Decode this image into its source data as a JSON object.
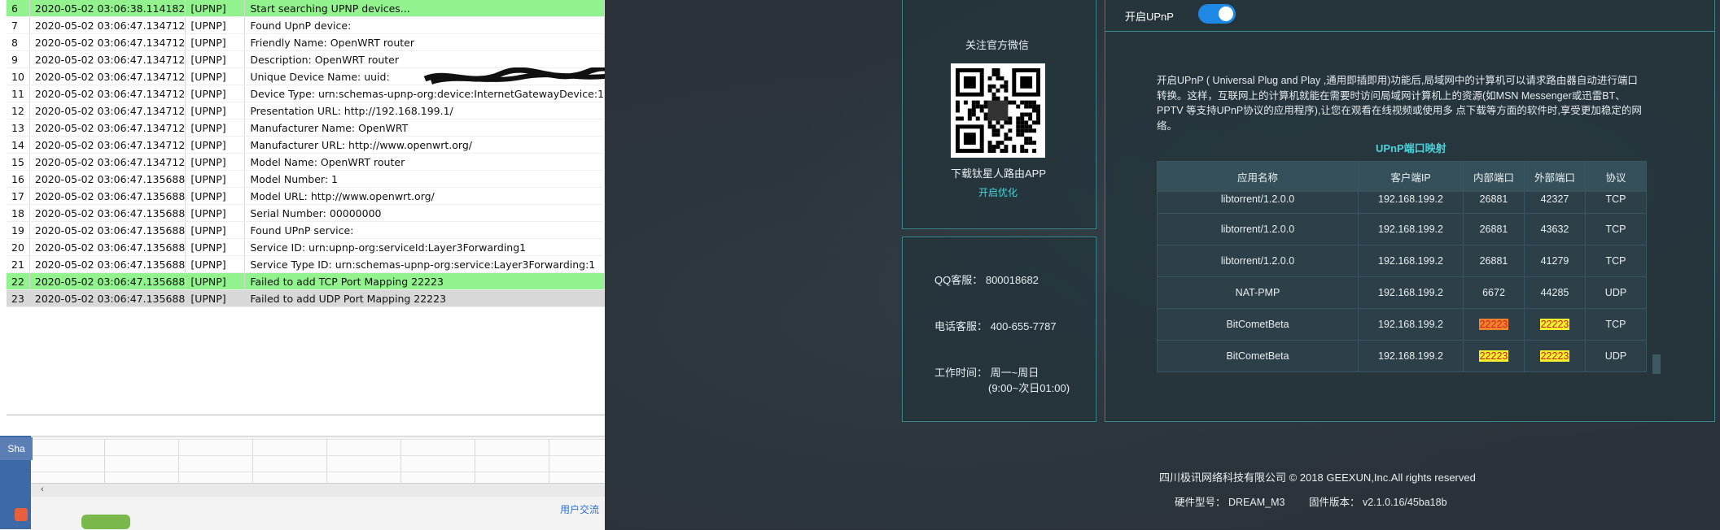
{
  "log": {
    "rows": [
      {
        "num": "6",
        "time": "2020-05-02 03:06:38.114182",
        "tag": "[UPNP]",
        "msg": "Start searching UPNP devices...",
        "hl": "green"
      },
      {
        "num": "7",
        "time": "2020-05-02 03:06:47.134712",
        "tag": "[UPNP]",
        "msg": "Found UpnP device:",
        "hl": ""
      },
      {
        "num": "8",
        "time": "2020-05-02 03:06:47.134712",
        "tag": "[UPNP]",
        "msg": "Friendly Name: OpenWRT router",
        "hl": ""
      },
      {
        "num": "9",
        "time": "2020-05-02 03:06:47.134712",
        "tag": "[UPNP]",
        "msg": "Description: OpenWRT router",
        "hl": ""
      },
      {
        "num": "10",
        "time": "2020-05-02 03:06:47.134712",
        "tag": "[UPNP]",
        "msg": "Unique Device Name: uuid:",
        "hl": ""
      },
      {
        "num": "11",
        "time": "2020-05-02 03:06:47.134712",
        "tag": "[UPNP]",
        "msg": "Device Type: urn:schemas-upnp-org:device:InternetGatewayDevice:1",
        "hl": ""
      },
      {
        "num": "12",
        "time": "2020-05-02 03:06:47.134712",
        "tag": "[UPNP]",
        "msg": "Presentation URL: http://192.168.199.1/",
        "hl": ""
      },
      {
        "num": "13",
        "time": "2020-05-02 03:06:47.134712",
        "tag": "[UPNP]",
        "msg": "Manufacturer Name: OpenWRT",
        "hl": ""
      },
      {
        "num": "14",
        "time": "2020-05-02 03:06:47.134712",
        "tag": "[UPNP]",
        "msg": "Manufacturer URL: http://www.openwrt.org/",
        "hl": ""
      },
      {
        "num": "15",
        "time": "2020-05-02 03:06:47.134712",
        "tag": "[UPNP]",
        "msg": "Model Name: OpenWRT router",
        "hl": ""
      },
      {
        "num": "16",
        "time": "2020-05-02 03:06:47.135688",
        "tag": "[UPNP]",
        "msg": "Model Number: 1",
        "hl": ""
      },
      {
        "num": "17",
        "time": "2020-05-02 03:06:47.135688",
        "tag": "[UPNP]",
        "msg": "Model URL: http://www.openwrt.org/",
        "hl": ""
      },
      {
        "num": "18",
        "time": "2020-05-02 03:06:47.135688",
        "tag": "[UPNP]",
        "msg": "Serial Number: 00000000",
        "hl": ""
      },
      {
        "num": "19",
        "time": "2020-05-02 03:06:47.135688",
        "tag": "[UPNP]",
        "msg": "Found UPnP service:",
        "hl": ""
      },
      {
        "num": "20",
        "time": "2020-05-02 03:06:47.135688",
        "tag": "[UPNP]",
        "msg": "Service ID: urn:upnp-org:serviceId:Layer3Forwarding1",
        "hl": ""
      },
      {
        "num": "21",
        "time": "2020-05-02 03:06:47.135688",
        "tag": "[UPNP]",
        "msg": "Service Type ID: urn:schemas-upnp-org:service:Layer3Forwarding:1",
        "hl": ""
      },
      {
        "num": "22",
        "time": "2020-05-02 03:06:47.135688",
        "tag": "[UPNP]",
        "msg": "Failed to add TCP Port Mapping 22223",
        "hl": "green"
      },
      {
        "num": "23",
        "time": "2020-05-02 03:06:47.135688",
        "tag": "[UPNP]",
        "msg": "Failed to add UDP Port Mapping 22223",
        "hl": "gray"
      }
    ],
    "sheet_tab": "Sha",
    "user_exchange": "用户交流"
  },
  "router": {
    "wechat_title": "关注官方微信",
    "download_app": "下载钛星人路由APP",
    "enable_optimize": "开启优化",
    "qq": "QQ客服：  800018682",
    "phone": "电话客服：  400-655-7787",
    "hours_label": "工作时间：  周一~周日",
    "hours_range": "(9:00~次日01:00)",
    "upnp_toggle_label": "开启UPnP",
    "upnp_enabled": true,
    "description": "开启UPnP ( Universal Plug and Play ,通用即插即用)功能后,局域网中的计算机可以请求路由器自动进行端口转换。这样，互联网上的计算机就能在需要时访问局域网计算机上的资源(如MSN Messenger或迅雷BT、PPTV 等支持UPnP协议的应用程序),让您在观看在线视频或使用多 点下载等方面的软件时,享受更加稳定的网络。",
    "mapping_title": "UPnP端口映射",
    "mapping_headers": [
      "应用名称",
      "客户端IP",
      "内部端口",
      "外部端口",
      "协议"
    ],
    "mapping_rows": [
      {
        "app": "libtorrent/1.2.0.0",
        "ip": "192.168.199.2",
        "internal": "26881",
        "external": "42327",
        "proto": "TCP",
        "hl_int": "",
        "hl_ext": ""
      },
      {
        "app": "libtorrent/1.2.0.0",
        "ip": "192.168.199.2",
        "internal": "26881",
        "external": "43632",
        "proto": "TCP",
        "hl_int": "",
        "hl_ext": ""
      },
      {
        "app": "libtorrent/1.2.0.0",
        "ip": "192.168.199.2",
        "internal": "26881",
        "external": "41279",
        "proto": "TCP",
        "hl_int": "",
        "hl_ext": ""
      },
      {
        "app": "NAT-PMP",
        "ip": "192.168.199.2",
        "internal": "6672",
        "external": "44285",
        "proto": "UDP",
        "hl_int": "",
        "hl_ext": ""
      },
      {
        "app": "BitCometBeta",
        "ip": "192.168.199.2",
        "internal": "22223",
        "external": "22223",
        "proto": "TCP",
        "hl_int": "orange",
        "hl_ext": "yellow"
      },
      {
        "app": "BitCometBeta",
        "ip": "192.168.199.2",
        "internal": "22223",
        "external": "22223",
        "proto": "UDP",
        "hl_int": "yellow",
        "hl_ext": "yellow"
      }
    ],
    "footer_copyright": "四川极讯网络科技有限公司 © 2018 GEEXUN,Inc.All rights reserved",
    "hardware_model": "硬件型号：  DREAM_M3",
    "firmware_version": "固件版本：  v2.1.0.16/45ba18b"
  },
  "colors": {
    "accent": "#4fd1d9",
    "toggle": "#1e88e5",
    "highlight_green": "#92f28d",
    "highlight_orange": "#f0842d",
    "highlight_yellow": "#f4f22c"
  }
}
